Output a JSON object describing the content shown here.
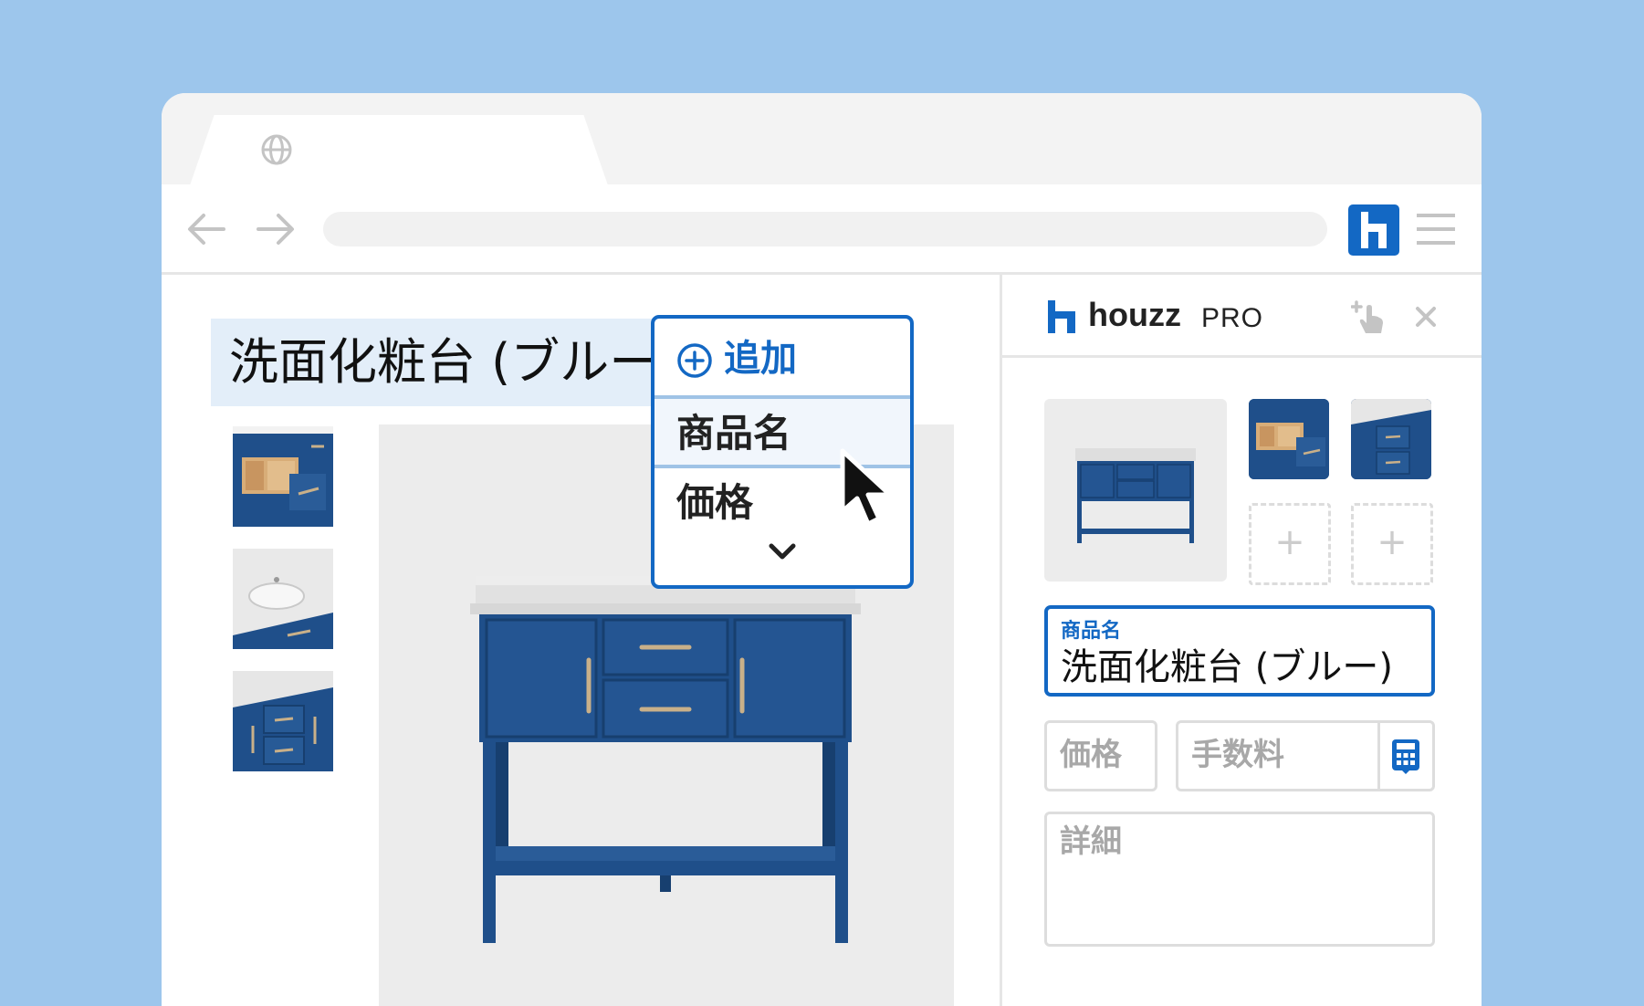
{
  "page": {
    "headline": "洗面化粧台 (ブルー)"
  },
  "popup": {
    "add_label": "追加",
    "items": [
      "商品名",
      "価格"
    ]
  },
  "panel": {
    "logo_text": "houzz",
    "logo_pro": "PRO",
    "plus_symbol": "+",
    "name_field_label": "商品名",
    "name_field_value": "洗面化粧台 (ブルー)",
    "price_placeholder": "価格",
    "fee_placeholder": "手数料",
    "detail_placeholder": "詳細"
  },
  "icons": {
    "tab": "globe-icon",
    "back": "arrow-left-icon",
    "forward": "arrow-right-icon",
    "extension": "houzz-logo-icon",
    "menu": "hamburger-menu-icon",
    "add": "plus-circle-icon",
    "expand": "chevron-down-icon",
    "pointer": "mouse-cursor-icon",
    "pick": "hand-pointer-plus-icon",
    "close": "close-icon",
    "calculator": "calculator-icon"
  },
  "colors": {
    "background": "#9dc6ec",
    "accent": "#1368c4",
    "vanity_blue": "#1f4f8a",
    "highlight": "#e3eef9"
  }
}
